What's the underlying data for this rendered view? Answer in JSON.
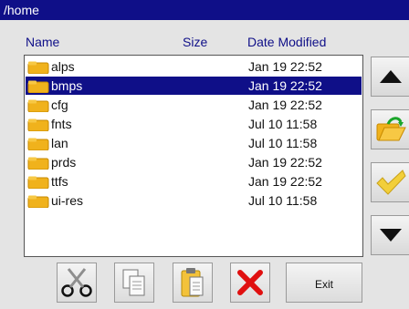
{
  "window": {
    "path": "/home"
  },
  "columns": {
    "name": "Name",
    "size": "Size",
    "date": "Date Modified"
  },
  "files": [
    {
      "name": "alps",
      "date": "Jan 19 22:52"
    },
    {
      "name": "bmps",
      "date": "Jan 19 22:52"
    },
    {
      "name": "cfg",
      "date": "Jan 19 22:52"
    },
    {
      "name": "fnts",
      "date": "Jul 10 11:58"
    },
    {
      "name": "lan",
      "date": "Jul 10 11:58"
    },
    {
      "name": "prds",
      "date": "Jan 19 22:52"
    },
    {
      "name": "ttfs",
      "date": "Jan 19 22:52"
    },
    {
      "name": "ui-res",
      "date": "Jul 10 11:58"
    }
  ],
  "selected_index": 1,
  "buttons": {
    "exit": "Exit"
  },
  "icons": {
    "scroll_up": "arrow-up-icon",
    "open": "open-folder-icon",
    "confirm": "checkmark-icon",
    "scroll_down": "arrow-down-icon",
    "cut": "scissors-icon",
    "copy": "copy-icon",
    "paste": "paste-icon",
    "delete": "delete-x-icon"
  },
  "colors": {
    "accent": "#0f0f88",
    "background": "#e4e4e4",
    "folder": "#f0b21c",
    "delete": "#e01010",
    "confirm": "#f2cf3a",
    "open_arrow": "#1aa52a"
  }
}
